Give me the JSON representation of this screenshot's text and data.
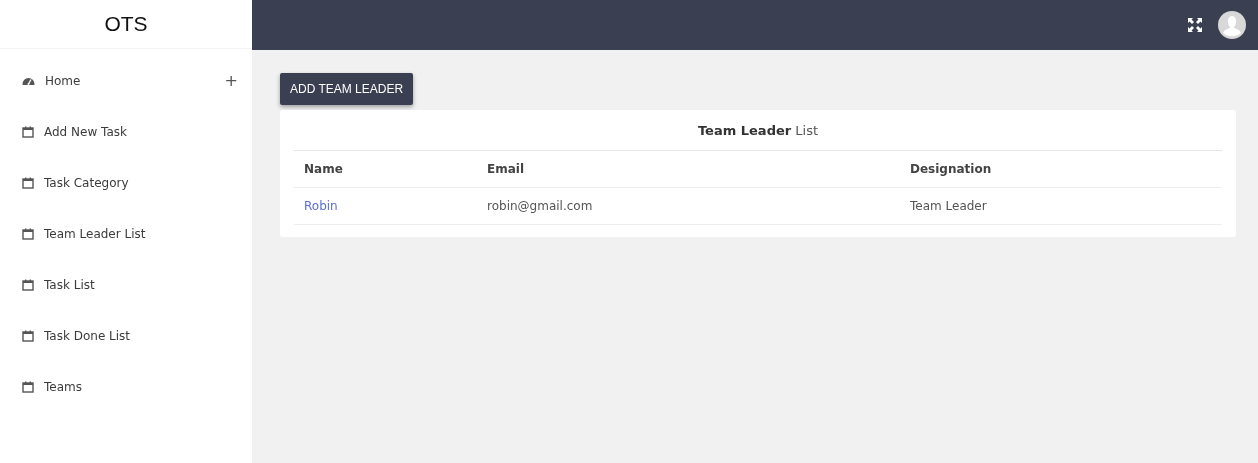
{
  "sidebar": {
    "logo": "OTS",
    "items": [
      {
        "kind": "dashboard",
        "label": "Home",
        "toggle": "+"
      },
      {
        "kind": "link",
        "label": "Add New Task"
      },
      {
        "kind": "link",
        "label": "Task Category"
      },
      {
        "kind": "link",
        "label": "Team Leader List"
      },
      {
        "kind": "link",
        "label": "Task List"
      },
      {
        "kind": "link",
        "label": "Task Done List"
      },
      {
        "kind": "link",
        "label": "Teams"
      }
    ]
  },
  "add_button": "ADD TEAM LEADER",
  "card": {
    "title": "**Team Leader** List",
    "table": {
      "columns": [
        "Name",
        "Email",
        "Designation"
      ],
      "rows": [
        {
          "name": "Robin",
          "email": "robin@gmail.com",
          "designation": "Team Leader"
        }
      ]
    }
  }
}
